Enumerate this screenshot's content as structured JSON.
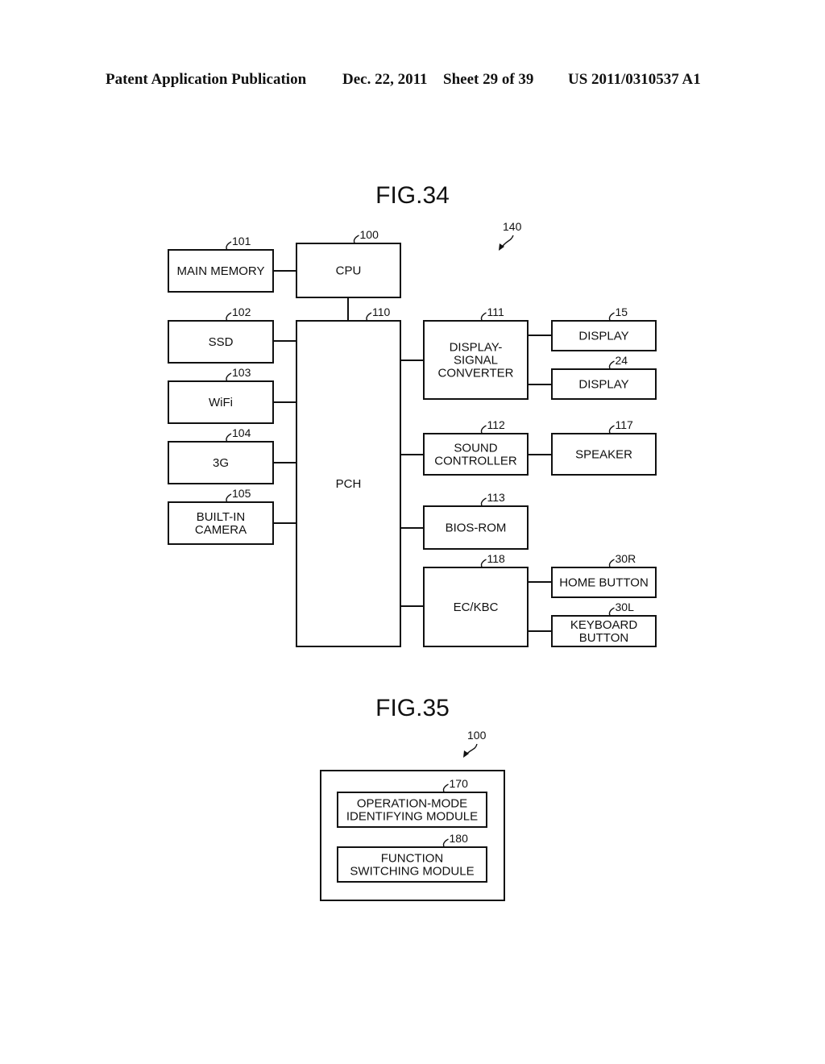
{
  "header": {
    "publication": "Patent Application Publication",
    "date": "Dec. 22, 2011",
    "sheet": "Sheet 29 of 39",
    "number": "US 2011/0310537 A1"
  },
  "fig34": {
    "title": "FIG.34",
    "system_ref": "140",
    "blocks": [
      {
        "id": "main-memory",
        "ref": "101",
        "lines": [
          "MAIN MEMORY"
        ]
      },
      {
        "id": "cpu",
        "ref": "100",
        "lines": [
          "CPU"
        ]
      },
      {
        "id": "ssd",
        "ref": "102",
        "lines": [
          "SSD"
        ]
      },
      {
        "id": "wifi",
        "ref": "103",
        "lines": [
          "WiFi"
        ]
      },
      {
        "id": "3g",
        "ref": "104",
        "lines": [
          "3G"
        ]
      },
      {
        "id": "built-in-camera",
        "ref": "105",
        "lines": [
          "BUILT-IN",
          "CAMERA"
        ]
      },
      {
        "id": "pch",
        "ref": "110",
        "lines": [
          "PCH"
        ]
      },
      {
        "id": "display-signal-converter",
        "ref": "111",
        "lines": [
          "DISPLAY-",
          "SIGNAL",
          "CONVERTER"
        ]
      },
      {
        "id": "display-15",
        "ref": "15",
        "lines": [
          "DISPLAY"
        ]
      },
      {
        "id": "display-24",
        "ref": "24",
        "lines": [
          "DISPLAY"
        ]
      },
      {
        "id": "sound-controller",
        "ref": "112",
        "lines": [
          "SOUND",
          "CONTROLLER"
        ]
      },
      {
        "id": "speaker",
        "ref": "117",
        "lines": [
          "SPEAKER"
        ]
      },
      {
        "id": "bios-rom",
        "ref": "113",
        "lines": [
          "BIOS-ROM"
        ]
      },
      {
        "id": "ec-kbc",
        "ref": "118",
        "lines": [
          "EC/KBC"
        ]
      },
      {
        "id": "home-button",
        "ref": "30R",
        "lines": [
          "HOME BUTTON"
        ]
      },
      {
        "id": "keyboard-button",
        "ref": "30L",
        "lines": [
          "KEYBOARD",
          "BUTTON"
        ]
      }
    ],
    "connections": [
      [
        "main-memory",
        "cpu"
      ],
      [
        "cpu",
        "pch"
      ],
      [
        "ssd",
        "pch"
      ],
      [
        "wifi",
        "pch"
      ],
      [
        "3g",
        "pch"
      ],
      [
        "built-in-camera",
        "pch"
      ],
      [
        "pch",
        "display-signal-converter"
      ],
      [
        "display-signal-converter",
        "display-15"
      ],
      [
        "display-signal-converter",
        "display-24"
      ],
      [
        "pch",
        "sound-controller"
      ],
      [
        "sound-controller",
        "speaker"
      ],
      [
        "pch",
        "bios-rom"
      ],
      [
        "pch",
        "ec-kbc"
      ],
      [
        "ec-kbc",
        "home-button"
      ],
      [
        "ec-kbc",
        "keyboard-button"
      ]
    ]
  },
  "fig35": {
    "title": "FIG.35",
    "container_ref": "100",
    "blocks": [
      {
        "id": "operation-mode-identifying-module",
        "ref": "170",
        "lines": [
          "OPERATION-MODE",
          "IDENTIFYING MODULE"
        ]
      },
      {
        "id": "function-switching-module",
        "ref": "180",
        "lines": [
          "FUNCTION",
          "SWITCHING MODULE"
        ]
      }
    ]
  }
}
